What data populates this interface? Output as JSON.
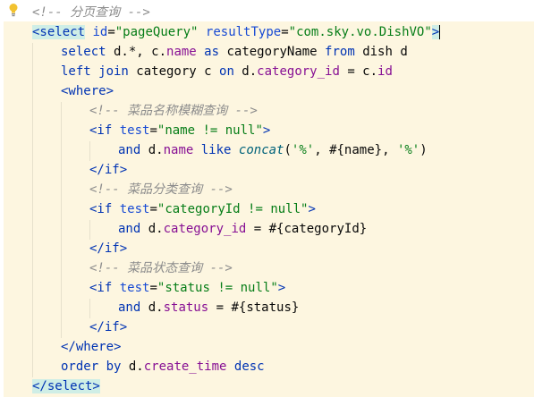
{
  "editor": {
    "lines": [
      {
        "indent": 0,
        "tokens": [
          {
            "t": "<!-- 分页查询 -->",
            "c": "cm"
          }
        ]
      },
      {
        "indent": 0,
        "tokens": [
          {
            "t": "<select",
            "c": "tag tagbox"
          },
          {
            "t": " "
          },
          {
            "t": "id",
            "c": "attr"
          },
          {
            "t": "="
          },
          {
            "t": "\"pageQuery\"",
            "c": "str"
          },
          {
            "t": " "
          },
          {
            "t": "resultType",
            "c": "attr"
          },
          {
            "t": "="
          },
          {
            "t": "\"com.sky.vo.DishVO\"",
            "c": "str"
          },
          {
            "t": ">",
            "c": "tag tagbox"
          },
          {
            "t": "",
            "c": "caret"
          }
        ]
      },
      {
        "indent": 1,
        "tokens": [
          {
            "t": "select",
            "c": "kw"
          },
          {
            "t": " d.*, c."
          },
          {
            "t": "name",
            "c": "id"
          },
          {
            "t": " "
          },
          {
            "t": "as",
            "c": "kw"
          },
          {
            "t": " categoryName "
          },
          {
            "t": "from",
            "c": "kw"
          },
          {
            "t": " dish d"
          }
        ]
      },
      {
        "indent": 1,
        "tokens": [
          {
            "t": "left join",
            "c": "kw"
          },
          {
            "t": " category c "
          },
          {
            "t": "on",
            "c": "kw"
          },
          {
            "t": " d."
          },
          {
            "t": "category_id",
            "c": "id"
          },
          {
            "t": " = c."
          },
          {
            "t": "id",
            "c": "id"
          }
        ]
      },
      {
        "indent": 1,
        "tokens": [
          {
            "t": "<where>",
            "c": "tag"
          }
        ]
      },
      {
        "indent": 2,
        "tokens": [
          {
            "t": "<!-- 菜品名称模糊查询 -->",
            "c": "cm"
          }
        ]
      },
      {
        "indent": 2,
        "tokens": [
          {
            "t": "<if",
            "c": "tag"
          },
          {
            "t": " "
          },
          {
            "t": "test",
            "c": "attr"
          },
          {
            "t": "="
          },
          {
            "t": "\"name != null\"",
            "c": "str"
          },
          {
            "t": ">",
            "c": "tag"
          }
        ]
      },
      {
        "indent": 3,
        "tokens": [
          {
            "t": "and",
            "c": "kw"
          },
          {
            "t": " d."
          },
          {
            "t": "name",
            "c": "id"
          },
          {
            "t": " "
          },
          {
            "t": "like",
            "c": "kw"
          },
          {
            "t": " "
          },
          {
            "t": "concat",
            "c": "fn"
          },
          {
            "t": "("
          },
          {
            "t": "'%'",
            "c": "str"
          },
          {
            "t": ", #{name}, "
          },
          {
            "t": "'%'",
            "c": "str"
          },
          {
            "t": ")"
          }
        ]
      },
      {
        "indent": 2,
        "tokens": [
          {
            "t": "</if>",
            "c": "tag"
          }
        ]
      },
      {
        "indent": 2,
        "tokens": [
          {
            "t": "<!-- 菜品分类查询 -->",
            "c": "cm"
          }
        ]
      },
      {
        "indent": 2,
        "tokens": [
          {
            "t": "<if",
            "c": "tag"
          },
          {
            "t": " "
          },
          {
            "t": "test",
            "c": "attr"
          },
          {
            "t": "="
          },
          {
            "t": "\"categoryId != null\"",
            "c": "str"
          },
          {
            "t": ">",
            "c": "tag"
          }
        ]
      },
      {
        "indent": 3,
        "tokens": [
          {
            "t": "and",
            "c": "kw"
          },
          {
            "t": " d."
          },
          {
            "t": "category_id",
            "c": "id"
          },
          {
            "t": " = #{categoryId}"
          }
        ]
      },
      {
        "indent": 2,
        "tokens": [
          {
            "t": "</if>",
            "c": "tag"
          }
        ]
      },
      {
        "indent": 2,
        "tokens": [
          {
            "t": "<!-- 菜品状态查询 -->",
            "c": "cm"
          }
        ]
      },
      {
        "indent": 2,
        "tokens": [
          {
            "t": "<if",
            "c": "tag"
          },
          {
            "t": " "
          },
          {
            "t": "test",
            "c": "attr"
          },
          {
            "t": "="
          },
          {
            "t": "\"status != null\"",
            "c": "str"
          },
          {
            "t": ">",
            "c": "tag"
          }
        ]
      },
      {
        "indent": 3,
        "tokens": [
          {
            "t": "and",
            "c": "kw"
          },
          {
            "t": " d."
          },
          {
            "t": "status",
            "c": "id"
          },
          {
            "t": " = #{status}"
          }
        ]
      },
      {
        "indent": 2,
        "tokens": [
          {
            "t": "</if>",
            "c": "tag"
          }
        ]
      },
      {
        "indent": 1,
        "tokens": [
          {
            "t": "</where>",
            "c": "tag"
          }
        ]
      },
      {
        "indent": 1,
        "tokens": [
          {
            "t": "order by",
            "c": "kw"
          },
          {
            "t": " d."
          },
          {
            "t": "create_time",
            "c": "id"
          },
          {
            "t": " "
          },
          {
            "t": "desc",
            "c": "kw"
          }
        ]
      },
      {
        "indent": 0,
        "tokens": [
          {
            "t": "</select>",
            "c": "tag tagbox"
          }
        ]
      }
    ],
    "icons": {
      "intention": "lightbulb-icon"
    },
    "colors": {
      "background": "#ffffff",
      "scope_highlight": "#fdf6e0",
      "tag": "#0033b3",
      "string": "#067d17",
      "comment": "#8c8c8c",
      "identifier": "#871094",
      "function": "#00627a"
    }
  }
}
